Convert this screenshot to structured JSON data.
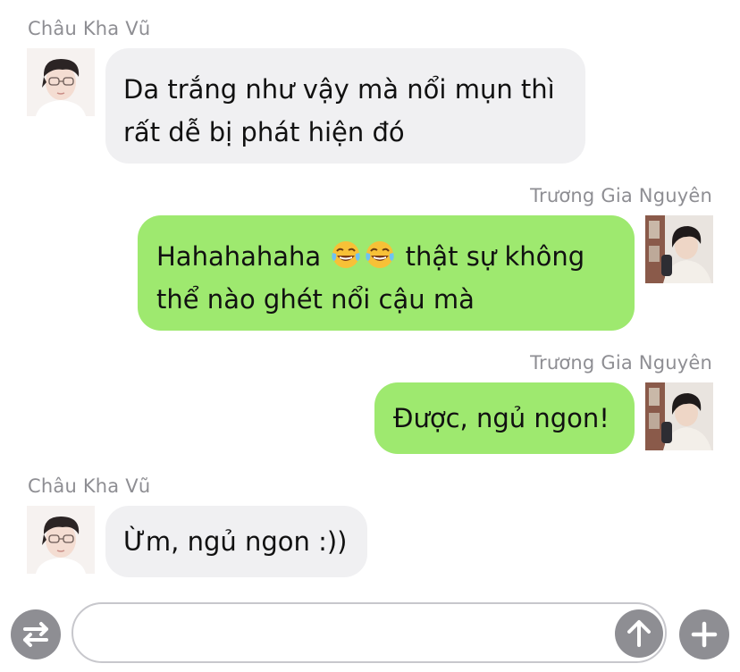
{
  "messages": [
    {
      "side": "left",
      "sender": "Châu Kha Vũ",
      "lines": [
        "Da trắng như vậy mà nổi mụn thì",
        "rất dễ bị phát hiện đó"
      ],
      "bubble_color": "#f0f0f2"
    },
    {
      "side": "right",
      "sender": "Trương Gia Nguyên",
      "line1_before": "Hahahahaha",
      "line1_emojis": [
        "face-with-tears-of-joy",
        "face-with-tears-of-joy"
      ],
      "line1_after": "thật sự không",
      "line2": "thể nào ghét nổi cậu mà",
      "bubble_color": "#9ee96f"
    },
    {
      "side": "right",
      "sender": "Trương Gia Nguyên",
      "lines": [
        "Được, ngủ ngon!"
      ],
      "bubble_color": "#9ee96f"
    },
    {
      "side": "left",
      "sender": "Châu Kha Vũ",
      "lines": [
        "Ừm, ngủ ngon :))"
      ],
      "bubble_color": "#f0f0f2"
    }
  ],
  "input_bar": {
    "value": "",
    "placeholder": "",
    "icons": {
      "left": "swap-arrows-icon",
      "send": "arrow-up-icon",
      "right": "plus-icon"
    },
    "icon_color": "#8e8e93"
  },
  "colors": {
    "sender_name": "#8e8e93",
    "outgoing_bubble": "#9ee96f",
    "incoming_bubble": "#f0f0f2"
  }
}
